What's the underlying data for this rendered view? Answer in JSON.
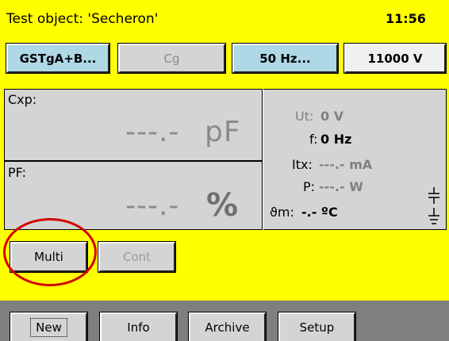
{
  "header": {
    "title": "Test object: 'Secheron'",
    "clock": "11:56"
  },
  "top_buttons": {
    "mode": "GSTgA+B...",
    "cg": "Cg",
    "freq": "50 Hz...",
    "voltage": "11000 V"
  },
  "measurements": {
    "cxp_label": "Cxp:",
    "cxp_value": "---.-",
    "cxp_unit": "pF",
    "pf_label": "PF:",
    "pf_value": "---.-",
    "pf_unit": "%"
  },
  "readouts": {
    "ut_label": "Ut:",
    "ut_value": "0 V",
    "f_label": "f:",
    "f_value": "0 Hz",
    "itx_label": "Itx:",
    "itx_value": "---.- mA",
    "p_label": "P:",
    "p_value": "---.- W",
    "theta_label": "ϑm:",
    "theta_value": "-.- ºC"
  },
  "action_buttons": {
    "multi": "Multi",
    "cont": "Cont"
  },
  "bottom_buttons": {
    "new": "New",
    "info": "Info",
    "archive": "Archive",
    "setup": "Setup"
  },
  "colors": {
    "background": "#ffff00",
    "panel": "#d4d4d4",
    "highlight_circle": "#d40000",
    "blue_button": "#aed8e6"
  },
  "icons": [
    "capacitor-icon",
    "ground-icon"
  ]
}
